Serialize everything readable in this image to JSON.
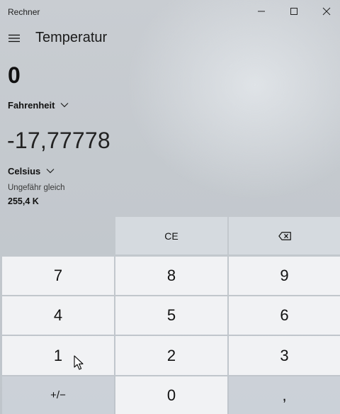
{
  "window": {
    "title": "Rechner"
  },
  "header": {
    "mode_title": "Temperatur"
  },
  "converter": {
    "input_value": "0",
    "from_unit": "Fahrenheit",
    "output_value": "-17,77778",
    "to_unit": "Celsius",
    "approx_label": "Ungefähr gleich",
    "approx_value": "255,4 K"
  },
  "keypad": {
    "clear_entry": "CE",
    "backspace_icon": "backspace-icon",
    "seven": "7",
    "eight": "8",
    "nine": "9",
    "four": "4",
    "five": "5",
    "six": "6",
    "one": "1",
    "two": "2",
    "three": "3",
    "negate": "+/−",
    "zero": "0",
    "decimal": ","
  },
  "icons": [
    "hamburger-icon",
    "minimize-icon",
    "maximize-icon",
    "close-icon",
    "chevron-down-icon",
    "backspace-icon",
    "mouse-cursor-icon"
  ]
}
